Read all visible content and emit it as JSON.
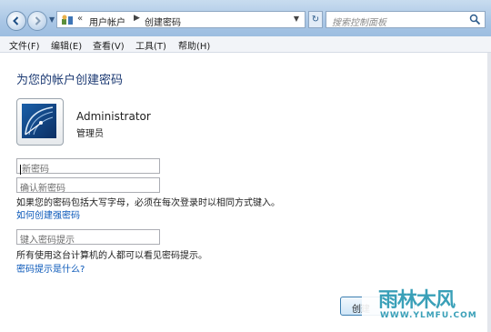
{
  "addressbar": {
    "arrows": "«",
    "crumb1": "用户帐户",
    "separator": "▶",
    "crumb2": "创建密码"
  },
  "search": {
    "placeholder": "搜索控制面板"
  },
  "menu": [
    "文件(F)",
    "编辑(E)",
    "查看(V)",
    "工具(T)",
    "帮助(H)"
  ],
  "main": {
    "title": "为您的帐户创建密码",
    "user_name": "Administrator",
    "user_role": "管理员",
    "new_password_placeholder": "新密码",
    "confirm_password_placeholder": "确认新密码",
    "case_note": "如果您的密码包括大写字母，必须在每次登录时以相同方式键入。",
    "strong_link": "如何创建强密码",
    "hint_placeholder": "键入密码提示",
    "hint_note": "所有使用这台计算机的人都可以看见密码提示。",
    "hint_link": "密码提示是什么?",
    "create_button": "创建"
  },
  "watermark": {
    "title": "雨林木风",
    "url": "WWW.YLMFU.COM"
  },
  "icons": [
    "back-arrow-icon",
    "forward-arrow-icon",
    "control-panel-icon",
    "refresh-icon",
    "search-icon",
    "user-picture-icon"
  ],
  "colors": {
    "title": "#1c3a73",
    "link": "#0a58b9",
    "watermark": "#3aa0b8"
  }
}
